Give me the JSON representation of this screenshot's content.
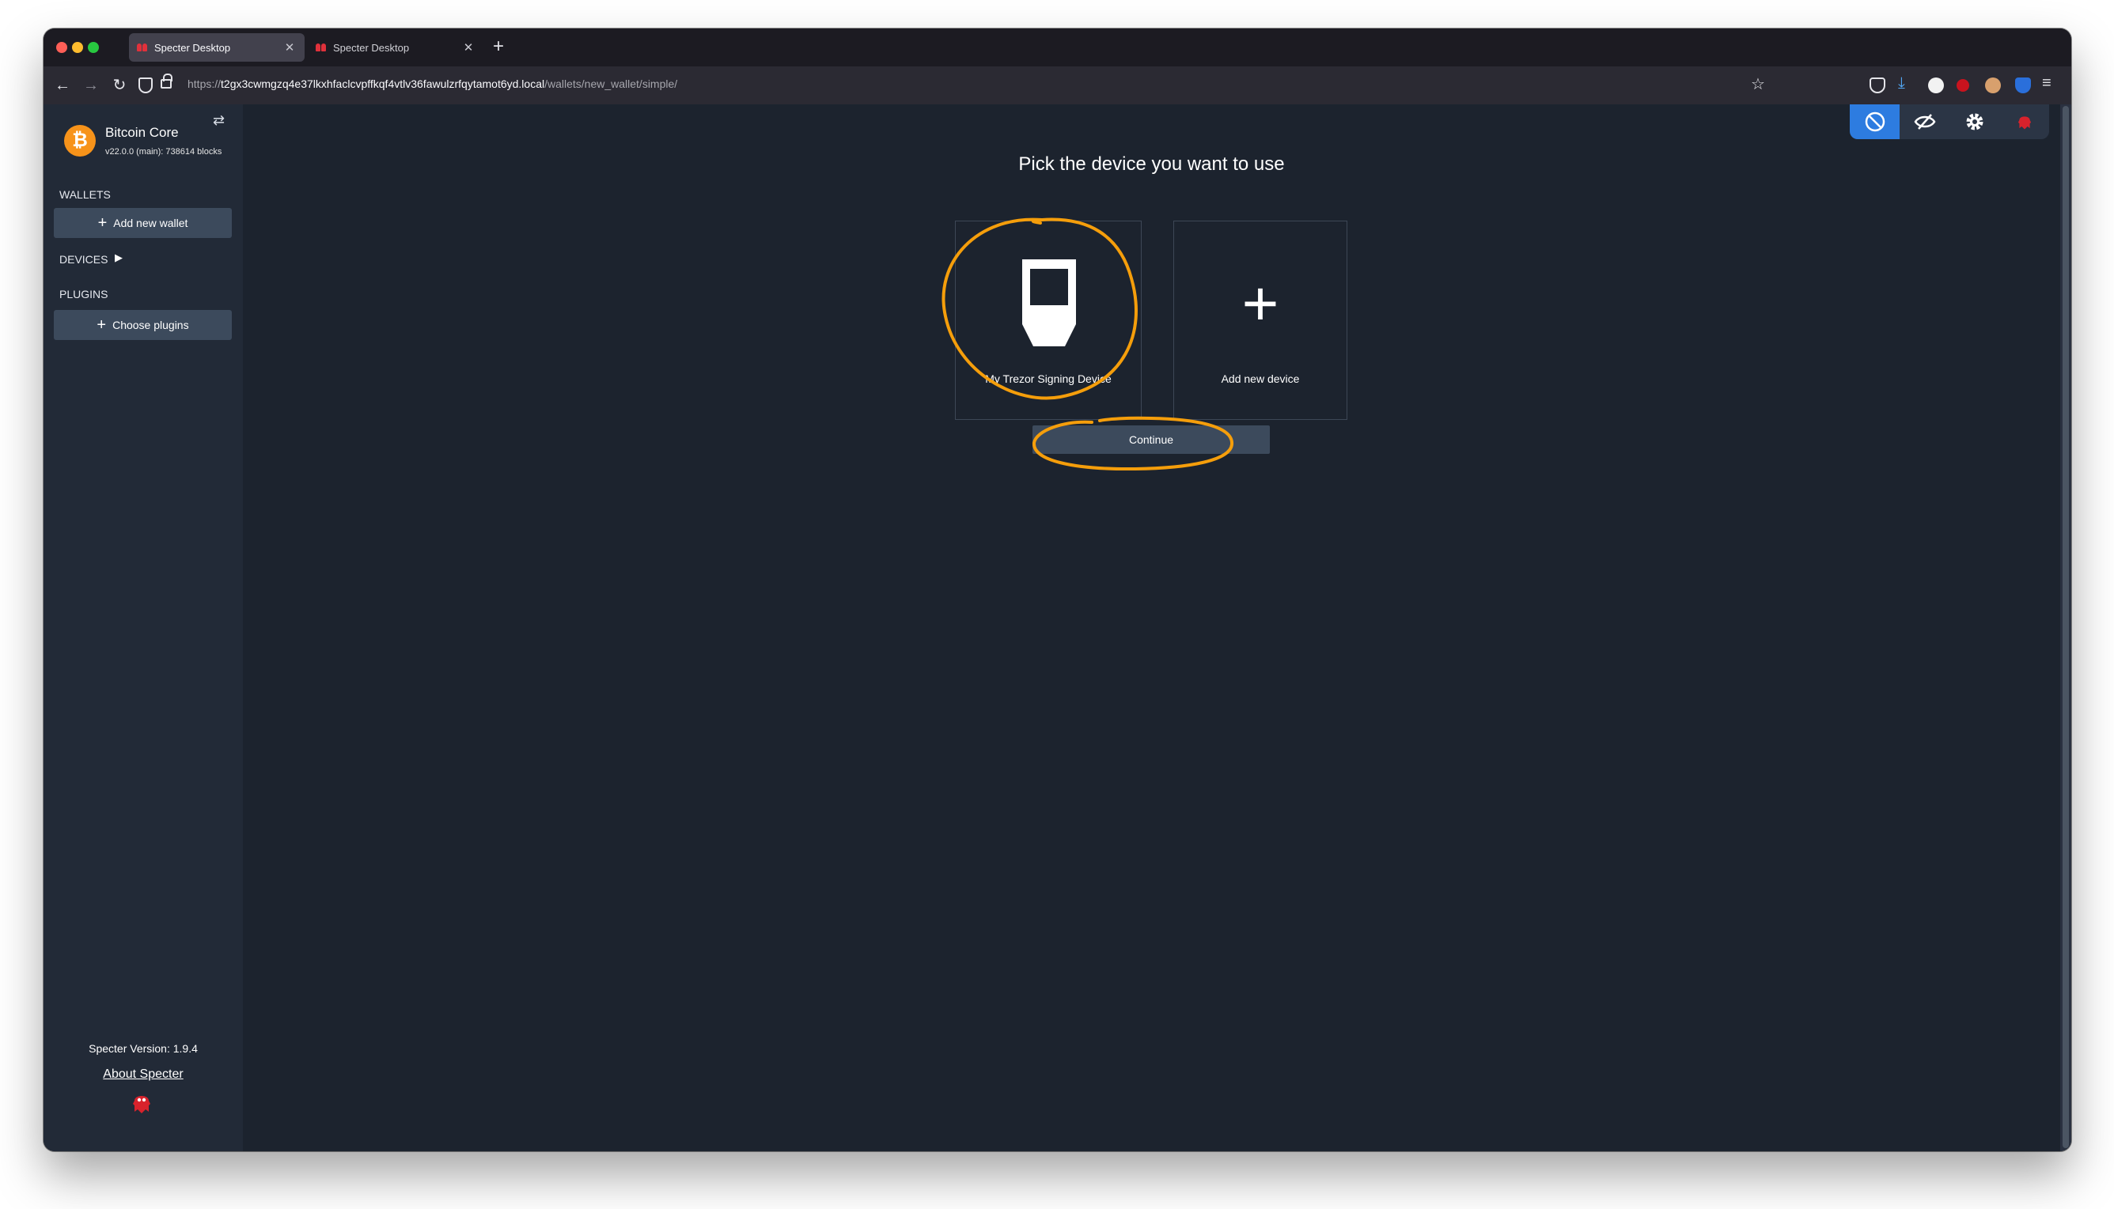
{
  "browser": {
    "tabs": [
      {
        "title": "Specter Desktop",
        "active": true
      },
      {
        "title": "Specter Desktop",
        "active": false
      }
    ],
    "url": {
      "scheme": "https://",
      "host": "t2gx3cwmgzq4e37lkxhfaclcvpffkqf4vtlv36fawulzrfqytamot6yd.local",
      "path": "/wallets/new_wallet/simple/"
    }
  },
  "sidebar": {
    "node_name": "Bitcoin Core",
    "node_info": "v22.0.0 (main): 738614 blocks",
    "wallets_label": "WALLETS",
    "add_wallet_label": "Add new wallet",
    "devices_label": "DEVICES",
    "plugins_label": "PLUGINS",
    "choose_plugins_label": "Choose plugins",
    "version_label": "Specter Version: ",
    "version_value": "1.9.4",
    "about_label": "About Specter"
  },
  "main": {
    "title": "Pick the device you want to use",
    "devices": [
      {
        "label": "My Trezor Signing Device",
        "icon": "trezor-icon",
        "highlighted": true
      },
      {
        "label": "Add new device",
        "icon": "plus-icon",
        "highlighted": false
      }
    ],
    "continue_label": "Continue"
  },
  "toolbar": {
    "items": [
      "tor-icon",
      "hide-balance-icon",
      "settings-gear-icon",
      "specter-ghost-icon"
    ],
    "active_color": "#2d7ce0"
  },
  "colors": {
    "annotation": "#f59e0b",
    "background": "#1c232e",
    "sidebar": "#222a37",
    "button": "#3c4a5c",
    "bitcoin": "#f7931a"
  }
}
